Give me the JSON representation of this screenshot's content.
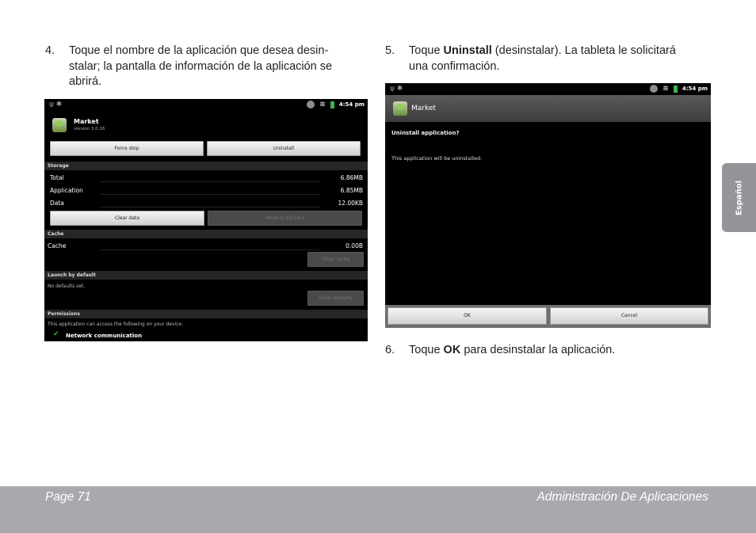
{
  "steps": {
    "s4": {
      "num": "4.",
      "lines": [
        "Toque el nombre de la aplicación que desea desin-",
        "stalar; la pantalla de información de la aplicación se",
        "abrirá."
      ]
    },
    "s5": {
      "num": "5.",
      "pre": "Toque ",
      "bold": "Uninstall",
      "post": " (desinstalar). La tableta le solicitará",
      "line2": "una confirmación."
    },
    "s6": {
      "num": "6.",
      "pre": "Toque ",
      "bold": "OK",
      "post": " para desinstalar la aplicación."
    }
  },
  "screen1": {
    "status_time": "4:54 pm",
    "app_name": "Market",
    "app_version": "version 3.0.26",
    "force_stop": "Force stop",
    "uninstall": "Uninstall",
    "storage_header": "Storage",
    "rows": [
      {
        "label": "Total",
        "value": "6.86MB"
      },
      {
        "label": "Application",
        "value": "6.85MB"
      },
      {
        "label": "Data",
        "value": "12.00KB"
      }
    ],
    "clear_data": "Clear data",
    "move_sd": "Move to SD card",
    "cache_header": "Cache",
    "cache_label": "Cache",
    "cache_value": "0.00B",
    "clear_cache": "Clear cache",
    "launch_header": "Launch by default",
    "no_defaults": "No defaults set.",
    "clear_defaults": "Clear defaults",
    "perm_header": "Permissions",
    "perm_desc": "This application can access the following on your device:",
    "perm_item": "Network communication"
  },
  "screen2": {
    "status_time": "4:54 pm",
    "title": "Market",
    "question": "Uninstall application?",
    "message": "This application will be uninstalled.",
    "ok": "OK",
    "cancel": "Cancel"
  },
  "sidetab": "Español",
  "footer": {
    "page": "Page 71",
    "section": "Administración De Aplicaciones"
  },
  "colors": {
    "footer_bg": "#a7a9ac",
    "sidetab_bg": "#939598",
    "android_green": "#3db54a"
  }
}
